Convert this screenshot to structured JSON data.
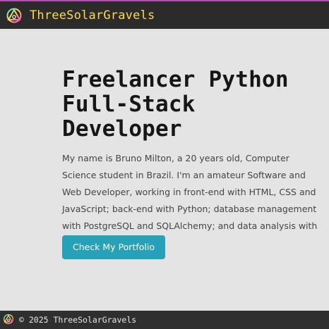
{
  "header": {
    "brand_name": "ThreeSolarGravels",
    "logo_icon": "triangle-circle-logo-icon"
  },
  "hero": {
    "title": "Freelancer Python Full-Stack Developer",
    "intro": "My name is Bruno Milton, a 20 years old, Computer Science student in Brazil. I'm an amateur Software and Web Developer, working in front-end with HTML, CSS and JavaScript; back-end with Python; database management with PostgreSQL and SQLAlchemy; and data analysis with Anaconda.",
    "cta_label": "Check My Portfolio"
  },
  "footer": {
    "copyright": "© 2025 ThreeSolarGravels"
  },
  "colors": {
    "background": "#e4e4e4",
    "topbar": "#2b2b2b",
    "accent": "#27a1b7",
    "brand_text": "#ffd84a"
  }
}
